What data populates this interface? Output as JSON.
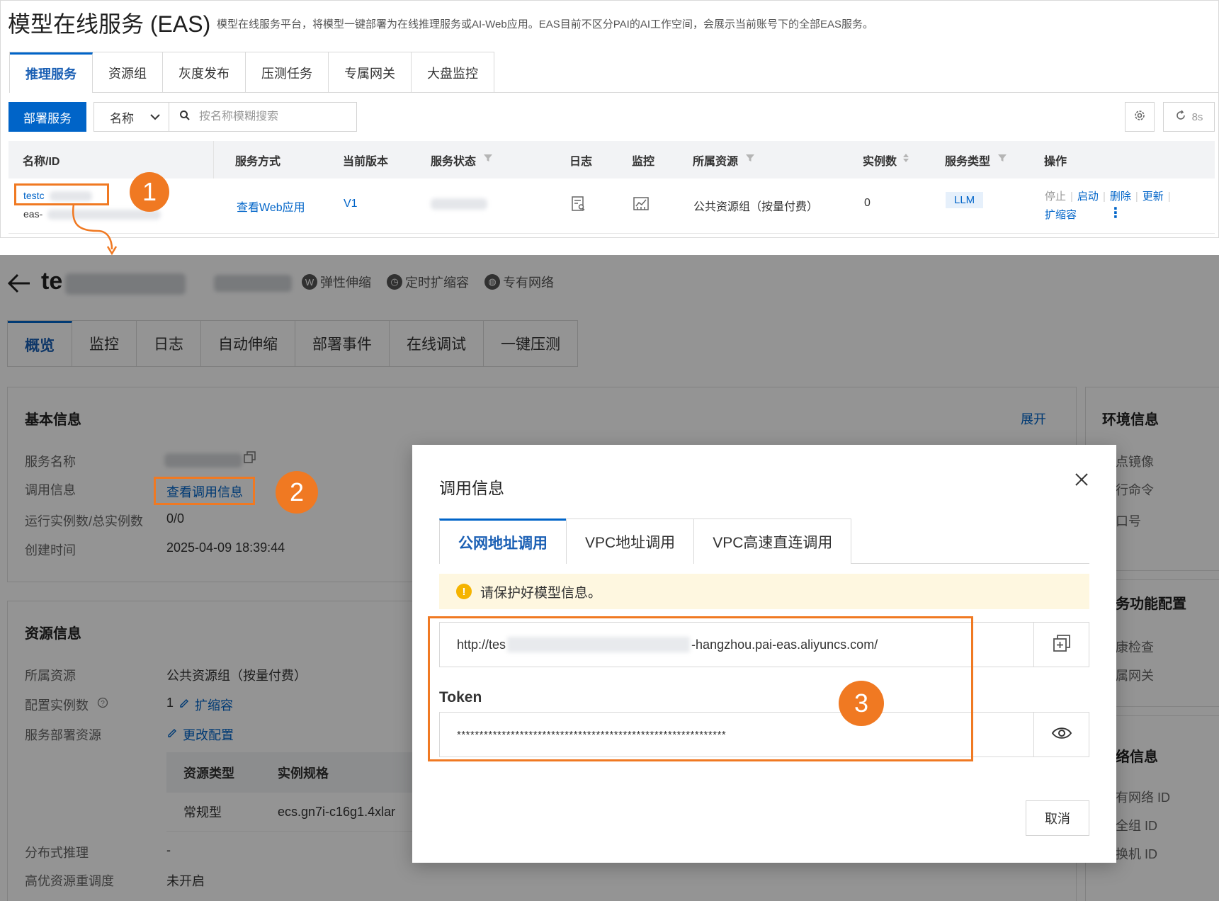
{
  "header": {
    "title": "模型在线服务 (EAS)",
    "description": "模型在线服务平台，将模型一键部署为在线推理服务或AI-Web应用。EAS目前不区分PAI的AI工作空间，会展示当前账号下的全部EAS服务。"
  },
  "tabs": [
    "推理服务",
    "资源组",
    "灰度发布",
    "压测任务",
    "专属网关",
    "大盘监控"
  ],
  "toolbar": {
    "deploy_label": "部署服务",
    "filter_value": "名称",
    "search_placeholder": "按名称模糊搜索",
    "refresh_label": "8s"
  },
  "table": {
    "headers": [
      "名称/ID",
      "服务方式",
      "当前版本",
      "服务状态",
      "日志",
      "监控",
      "所属资源",
      "实例数",
      "服务类型",
      "操作"
    ],
    "row": {
      "name": "testc",
      "id_prefix": "eas-",
      "service_mode": "查看Web应用",
      "version": "V1",
      "resource": "公共资源组（按量付费）",
      "instances": "0",
      "service_type": "LLM",
      "ops": {
        "stop": "停止",
        "start": "启动",
        "delete": "删除",
        "update": "更新",
        "scale": "扩缩容",
        "more": "⋮"
      }
    }
  },
  "markers": [
    "1",
    "2",
    "3"
  ],
  "detail": {
    "title_prefix": "te",
    "chips": [
      "弹性伸缩",
      "定时扩缩容",
      "专有网络"
    ],
    "tabs": [
      "概览",
      "监控",
      "日志",
      "自动伸缩",
      "部署事件",
      "在线调试",
      "一键压测"
    ],
    "basic": {
      "title": "基本信息",
      "expand": "展开",
      "labels": [
        "服务名称",
        "调用信息",
        "运行实例数/总实例数",
        "创建时间"
      ],
      "invoke_link": "查看调用信息",
      "instances": "0/0",
      "created": "2025-04-09 18:39:44"
    },
    "resource": {
      "title": "资源信息",
      "labels": [
        "所属资源",
        "配置实例数",
        "服务部署资源",
        "分布式推理",
        "高优资源重调度"
      ],
      "resource": "公共资源组（按量付费）",
      "instance_count": "1",
      "scale_link": "扩缩容",
      "change_link": "更改配置",
      "spec_headers": [
        "资源类型",
        "实例规格"
      ],
      "spec_row": [
        "常规型",
        "ecs.gn7i-c16g1.4xlar"
      ],
      "distributed": "-",
      "reschedule": "未开启"
    },
    "env": {
      "title": "环境信息",
      "items": [
        "点镜像",
        "行命令",
        "口号"
      ]
    },
    "feature": {
      "title": "务功能配置",
      "items": [
        "康检查",
        "属网关"
      ]
    },
    "network": {
      "title": "络信息",
      "items": [
        "有网络 ID",
        "全组 ID",
        "换机 ID"
      ]
    }
  },
  "modal": {
    "title": "调用信息",
    "close": "×",
    "tabs": [
      "公网地址调用",
      "VPC地址调用",
      "VPC高速直连调用"
    ],
    "warning": "请保护好模型信息。",
    "url_prefix": "http://tes",
    "url_suffix": "-hangzhou.pai-eas.aliyuncs.com/",
    "token_label": "Token",
    "token_value": "************************************************************",
    "cancel": "取消"
  },
  "colors": {
    "primary": "#0064c8",
    "highlight": "#f07922",
    "warning_bg": "#fef7e0"
  }
}
